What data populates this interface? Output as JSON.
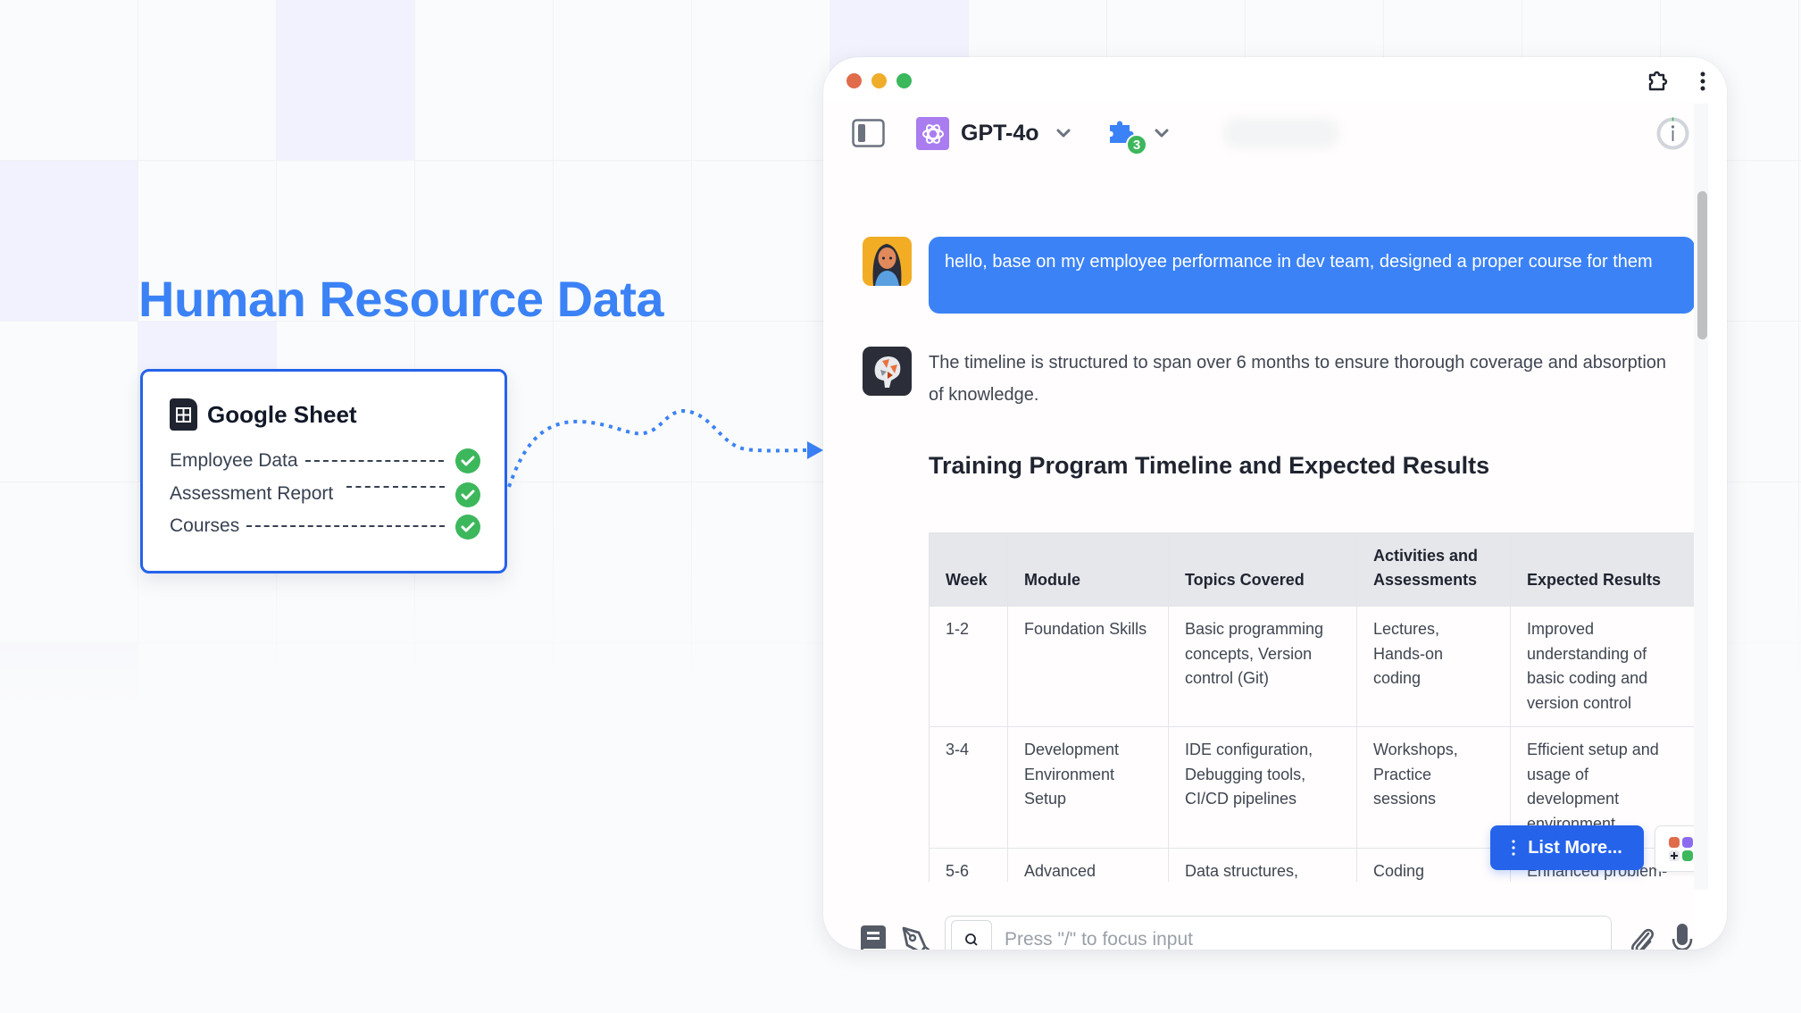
{
  "hero": {
    "title": "Human Resource Data"
  },
  "source_card": {
    "title": "Google Sheet",
    "icon": "spreadsheet-icon",
    "items": [
      {
        "label": "Employee Data",
        "status": "connected",
        "status_icon": "check-circle-icon"
      },
      {
        "label": "Assessment Report",
        "status": "connected",
        "status_icon": "check-circle-icon"
      },
      {
        "label": "Courses",
        "status": "connected",
        "status_icon": "check-circle-icon"
      }
    ]
  },
  "colors": {
    "accent": "#3b82f6",
    "button_blue": "#2563eb",
    "success": "#3db75c",
    "traffic_red": "#e06c4c",
    "traffic_yellow": "#f0ad2a",
    "traffic_green": "#3bb75c",
    "model_logo_bg": "#a97cf0"
  },
  "window": {
    "titlebar_icons": [
      "extension-icon",
      "more-vertical-icon"
    ],
    "toolbar": {
      "sidebar_toggle_icon": "sidebar-toggle-icon",
      "model_name": "GPT-4o",
      "model_icon": "openai-logo-icon",
      "plugin_icon": "puzzle-icon",
      "plugin_count": "3",
      "info_icon": "info-icon"
    }
  },
  "chat": {
    "messages": [
      {
        "role": "user",
        "avatar": "user-avatar",
        "text": "hello, base on my employee performance in dev team, designed a proper course for them"
      },
      {
        "role": "assistant",
        "avatar": "assistant-avatar",
        "text": "The timeline is structured to span over 6 months to ensure thorough coverage and absorption of knowledge.",
        "heading": "Training Program Timeline and Expected Results",
        "table": {
          "headers": [
            "Week",
            "Module",
            "Topics Covered",
            "Activities and Assessments",
            "Expected Results"
          ],
          "rows": [
            [
              "1-2",
              "Foundation Skills",
              "Basic programming concepts, Version control (Git)",
              "Lectures, Hands-on coding",
              "Improved understanding of basic coding and version control"
            ],
            [
              "3-4",
              "Development Environment Setup",
              "IDE configuration, Debugging tools, CI/CD pipelines",
              "Workshops, Practice sessions",
              "Efficient setup and usage of development environment"
            ],
            [
              "5-6",
              "Advanced",
              "Data structures,",
              "Coding",
              "Enhanced problem-"
            ]
          ]
        }
      }
    ],
    "list_more_label": "List More...",
    "apps_icon": "apps-grid-icon"
  },
  "composer": {
    "placeholder": "Press \"/\" to focus input",
    "value": "",
    "left_icons": [
      "prompt-library-icon",
      "pen-tool-icon"
    ],
    "right_icons": [
      "paperclip-icon",
      "microphone-icon"
    ]
  }
}
